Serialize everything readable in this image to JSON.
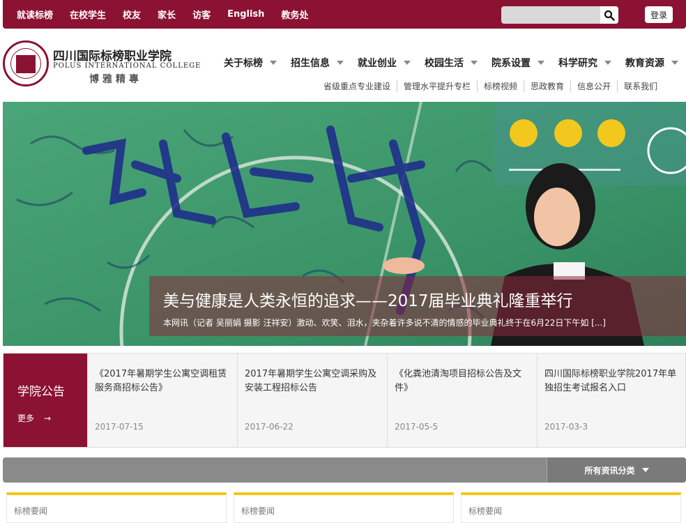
{
  "top_nav": [
    "就读标榜",
    "在校学生",
    "校友",
    "家长",
    "访客",
    "English",
    "教务处"
  ],
  "search": {
    "placeholder": "",
    "value": ""
  },
  "login_label": "登录",
  "logo": {
    "name_cn": "四川国际标榜职业学院",
    "name_en": "POLUS INTERNATIONAL COLLEGE",
    "motto": "博雅精專"
  },
  "main_nav": [
    "关于标榜",
    "招生信息",
    "就业创业",
    "校园生活",
    "院系设置",
    "科学研究",
    "教育资源"
  ],
  "sub_nav": [
    "省级重点专业建设",
    "管理水平提升专栏",
    "标榜视频",
    "思政教育",
    "信息公开",
    "联系我们"
  ],
  "banner": {
    "caption_title": "美与健康是人类永恒的追求——2017届毕业典礼隆重举行",
    "caption_text": "本网讯（记者 吴丽娟 摄影 汪祥安）激动、欢笑、泪水，夹杂着许多说不清的情感的毕业典礼终于在6月22日下午如 [...]"
  },
  "notices": {
    "title": "学院公告",
    "more_label": "更多",
    "items": [
      {
        "title": "《2017年暑期学生公寓空调租赁服务商招标公告》",
        "date": "2017-07-15"
      },
      {
        "title": "2017年暑期学生公寓空调采购及安装工程招标公告",
        "date": "2017-06-22"
      },
      {
        "title": "《化粪池清淘项目招标公告及文件》",
        "date": "2017-05-5"
      },
      {
        "title": "四川国际标榜职业学院2017年单独招生考试报名入口",
        "date": "2017-03-3"
      }
    ]
  },
  "category_label": "所有资讯分类",
  "news_columns": [
    "标榜要闻",
    "标榜要闻",
    "标榜要闻"
  ],
  "colors": {
    "brand": "#8b1232",
    "accent": "#f5c518",
    "bar": "#8a8a8a"
  },
  "icons": {
    "search": "search-icon",
    "more": "arrow-right-icon",
    "dropdown": "chevron-down-icon"
  }
}
